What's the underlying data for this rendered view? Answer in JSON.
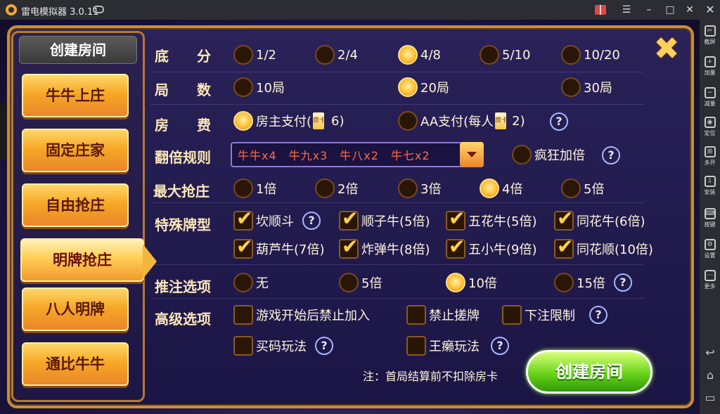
{
  "window": {
    "title": "雷电模拟器 3.0.11",
    "controls": {
      "menu": "☰",
      "minimize": "–",
      "maximize": "□",
      "close": "✕"
    }
  },
  "emulator_sidebar": {
    "items": [
      {
        "label": "截屏",
        "icon": "scissors-icon",
        "glyph": "✂"
      },
      {
        "label": "加量",
        "icon": "volume-up-icon",
        "glyph": "+"
      },
      {
        "label": "减量",
        "icon": "volume-down-icon",
        "glyph": "−"
      },
      {
        "label": "定位",
        "icon": "location-icon",
        "glyph": "◉"
      },
      {
        "label": "多开",
        "icon": "multi-instance-icon",
        "glyph": "⊞"
      },
      {
        "label": "安装",
        "icon": "install-icon",
        "glyph": "⇩"
      },
      {
        "label": "按键",
        "icon": "keyboard-icon",
        "glyph": "⌨"
      },
      {
        "label": "设置",
        "icon": "gear-icon",
        "glyph": "⚙"
      },
      {
        "label": "更多",
        "icon": "more-icon",
        "glyph": "⋯"
      }
    ],
    "nav": {
      "back": "↩",
      "home": "⌂",
      "recent": "▭"
    }
  },
  "left_panel": {
    "title": "创建房间",
    "modes": [
      {
        "label": "牛牛上庄",
        "active": false
      },
      {
        "label": "固定庄家",
        "active": false
      },
      {
        "label": "自由抢庄",
        "active": false
      },
      {
        "label": "明牌抢庄",
        "active": true
      },
      {
        "label": "八人明牌",
        "active": false
      },
      {
        "label": "通比牛牛",
        "active": false
      }
    ]
  },
  "close_symbol": "✖",
  "settings": {
    "base_score": {
      "label": "底　　分",
      "options": [
        "1/2",
        "2/4",
        "4/8",
        "5/10",
        "10/20"
      ],
      "selected": "4/8"
    },
    "rounds": {
      "label": "局　　数",
      "options": [
        "10局",
        "20局",
        "30局"
      ],
      "selected": "20局"
    },
    "room_fee": {
      "label": "房　　费",
      "owner_pay": "房主支付(",
      "owner_amount": "6)",
      "aa_pay": "AA支付(每人",
      "aa_amount": "2)",
      "selected": "owner",
      "card_icon_text": "房卡"
    },
    "double_rule": {
      "label": "翻倍规则",
      "dropdown_value": "牛牛x4　牛九x3　牛八x2　牛七x2",
      "crazy_label": "疯狂加倍",
      "crazy_checked": false
    },
    "max_grab": {
      "label": "最大抢庄",
      "options": [
        "1倍",
        "2倍",
        "3倍",
        "4倍",
        "5倍"
      ],
      "selected": "4倍"
    },
    "special_cards": {
      "label": "特殊牌型",
      "options": [
        {
          "text": "坎顺斗",
          "checked": true
        },
        {
          "text": "顺子牛(5倍)",
          "checked": true
        },
        {
          "text": "五花牛(5倍)",
          "checked": true
        },
        {
          "text": "同花牛(6倍)",
          "checked": true
        },
        {
          "text": "葫芦牛(7倍)",
          "checked": true
        },
        {
          "text": "炸弹牛(8倍)",
          "checked": true
        },
        {
          "text": "五小牛(9倍)",
          "checked": true
        },
        {
          "text": "同花顺(10倍)",
          "checked": true
        }
      ]
    },
    "push_bet": {
      "label": "推注选项",
      "options": [
        "无",
        "5倍",
        "10倍",
        "15倍"
      ],
      "selected": "10倍"
    },
    "advanced": {
      "label": "高级选项",
      "options": [
        {
          "text": "游戏开始后禁止加入",
          "checked": false
        },
        {
          "text": "禁止搓牌",
          "checked": false
        },
        {
          "text": "下注限制",
          "checked": false
        },
        {
          "text": "买码玩法",
          "checked": false
        },
        {
          "text": "王癞玩法",
          "checked": false
        }
      ]
    },
    "help_symbol": "?"
  },
  "footer": {
    "note": "注：首局结算前不扣除房卡",
    "create_button": "创建房间"
  }
}
